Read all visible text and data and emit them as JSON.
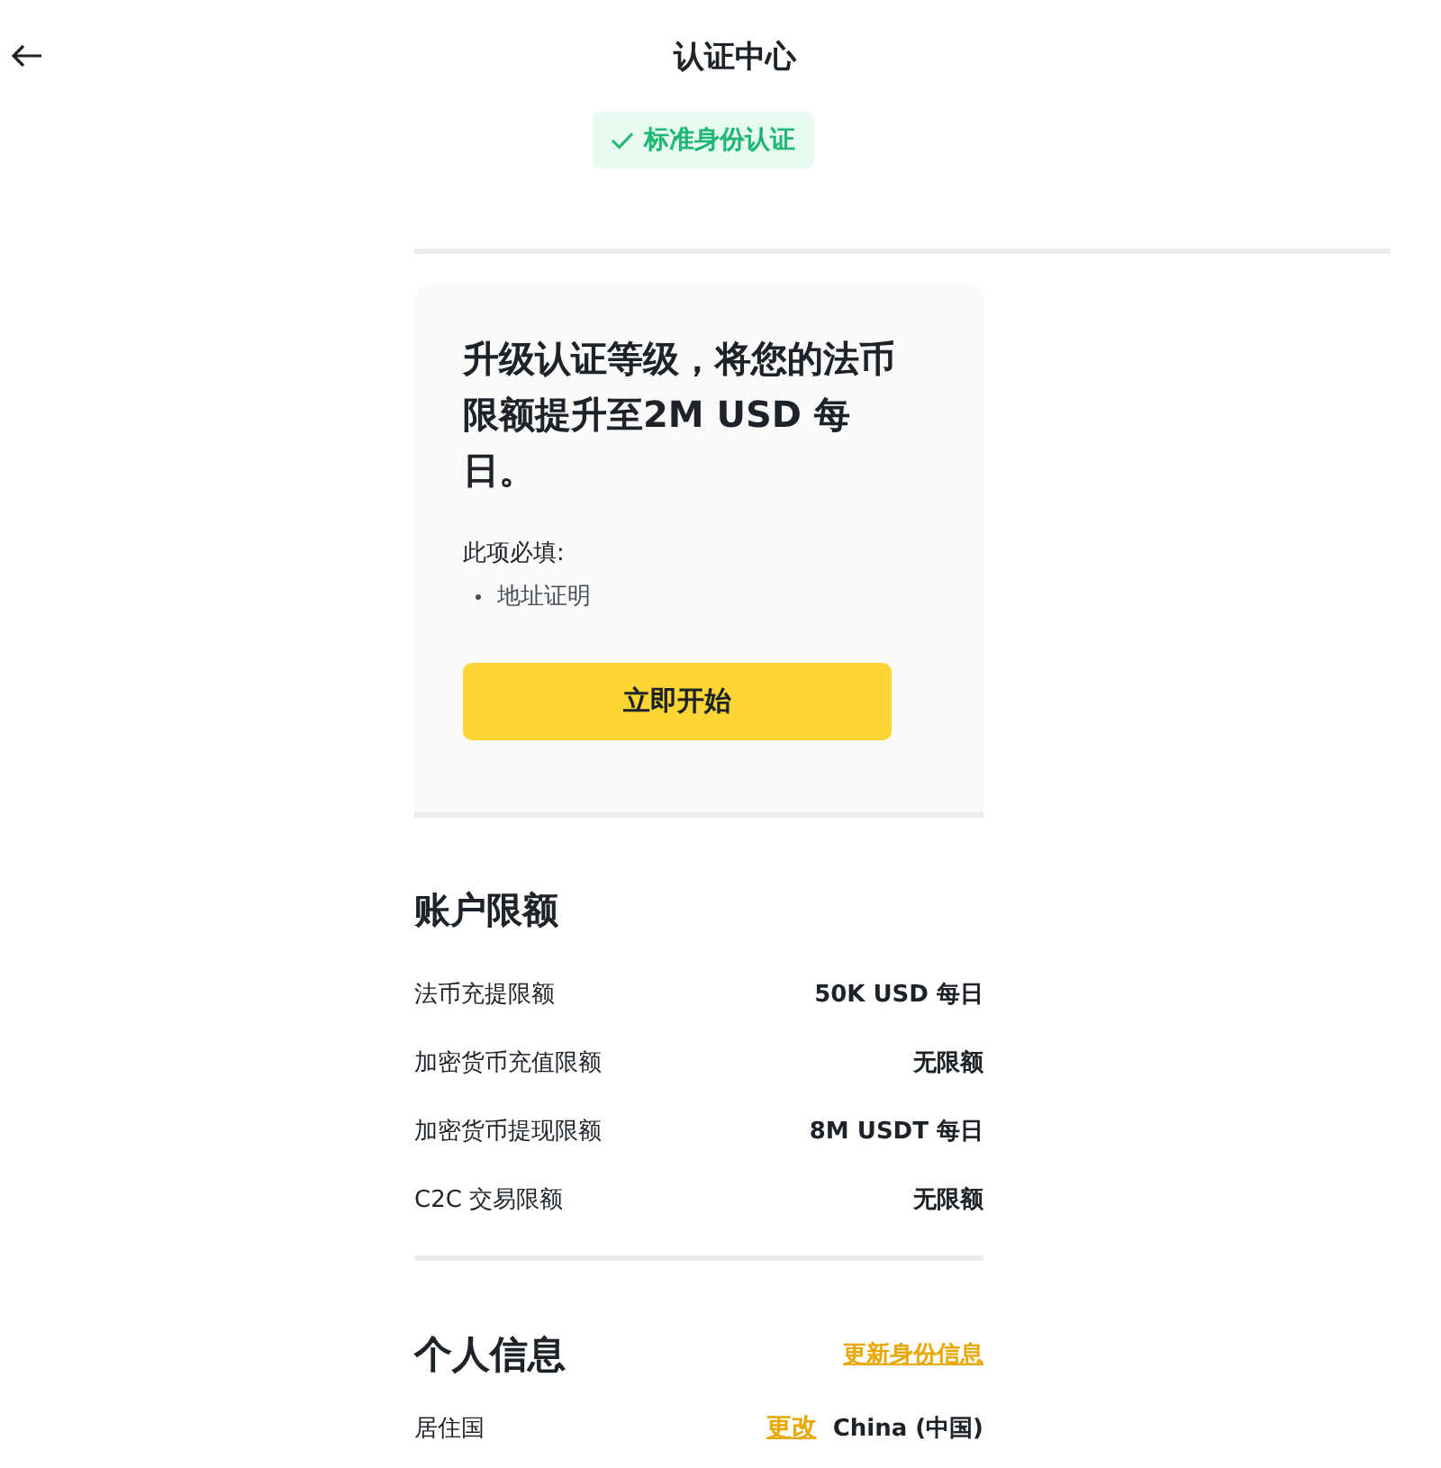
{
  "header": {
    "title": "认证中心",
    "badge": "标准身份认证"
  },
  "upgrade_card": {
    "heading": "升级认证等级，将您的法币限额提升至2M USD 每日。",
    "required_label": "此项必填:",
    "required_items": [
      "地址证明"
    ],
    "button": "立即开始"
  },
  "account_limits": {
    "title": "账户限额",
    "rows": [
      {
        "label": "法币充提限额",
        "value": "50K USD 每日"
      },
      {
        "label": "加密货币充值限额",
        "value": "无限额"
      },
      {
        "label": "加密货币提现限额",
        "value": "8M USDT 每日"
      },
      {
        "label": "C2C 交易限额",
        "value": "无限额"
      }
    ]
  },
  "personal_info": {
    "title": "个人信息",
    "link": "更新身份信息",
    "rows": [
      {
        "label": "居住国",
        "action": "更改",
        "value": "China (中国)"
      }
    ]
  }
}
